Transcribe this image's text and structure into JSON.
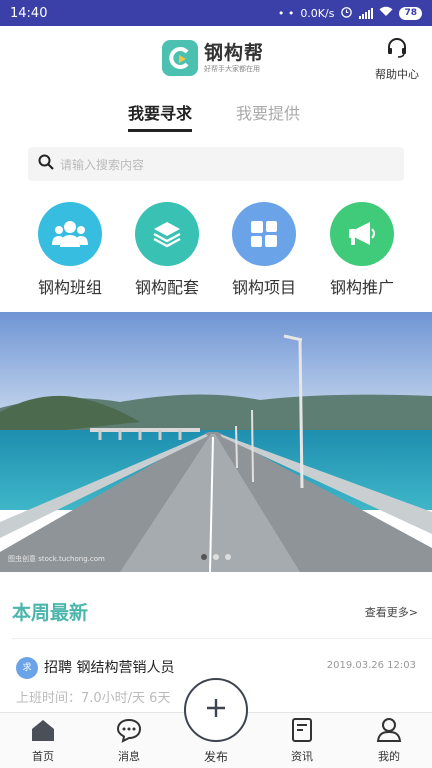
{
  "status_bar": {
    "time": "14:40",
    "dots": "• •",
    "speed": "0.0K/s",
    "battery": "78"
  },
  "header": {
    "app_name": "钢构帮",
    "slogan": "好帮手大家都在用",
    "help_label": "帮助中心"
  },
  "tabs": [
    {
      "label": "我要寻求",
      "active": true
    },
    {
      "label": "我要提供",
      "active": false
    }
  ],
  "search": {
    "placeholder": "请输入搜索内容"
  },
  "categories": [
    {
      "label": "钢构班组",
      "icon": "team-icon",
      "color": "#36bde0"
    },
    {
      "label": "钢构配套",
      "icon": "layers-icon",
      "color": "#39c1b3"
    },
    {
      "label": "钢构项目",
      "icon": "grid-icon",
      "color": "#6aa3e8"
    },
    {
      "label": "钢构推广",
      "icon": "megaphone-icon",
      "color": "#3fcb7a"
    }
  ],
  "banner": {
    "credit": "图虫创意 stock.tuchong.com",
    "slides": 3,
    "active_slide": 1
  },
  "weekly": {
    "title": "本周最新",
    "more": "查看更多>"
  },
  "post": {
    "badge": "求",
    "title": "招聘 钢结构营销人员",
    "time": "2019.03.26 12:03",
    "detail": "上班时间：7.0小时/天    6天"
  },
  "bottom_nav": [
    {
      "label": "首页",
      "icon": "home-icon"
    },
    {
      "label": "消息",
      "icon": "message-icon"
    },
    {
      "label": "发布",
      "icon": "plus-icon"
    },
    {
      "label": "资讯",
      "icon": "news-icon"
    },
    {
      "label": "我的",
      "icon": "user-icon"
    }
  ],
  "colors": {
    "status_bar": "#3b3fa8",
    "accent": "#4db6ac",
    "badge": "#6aa3e8"
  }
}
